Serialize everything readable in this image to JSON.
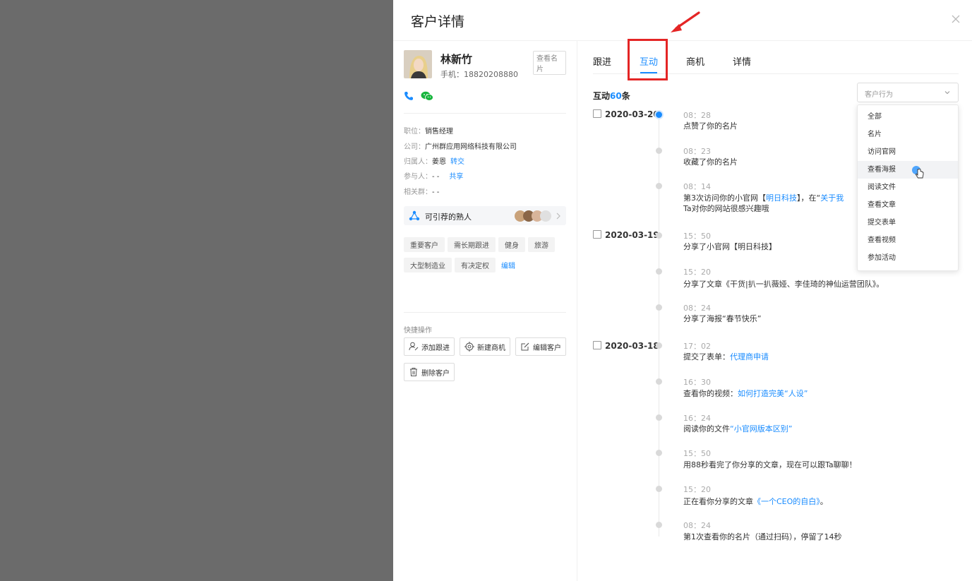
{
  "drawer": {
    "title": "客户详情"
  },
  "customer": {
    "name": "林新竹",
    "phone": "手机：18820208880",
    "view_card": "查看名片",
    "position_label": "职位：",
    "position": "销售经理",
    "company_label": "公司：",
    "company": "广州群应用网络科技有限公司",
    "owner_label": "归属人：",
    "owner": "姜恩",
    "owner_action": "转交",
    "participant_label": "参与人：",
    "participant": "- -",
    "participant_action": "共享",
    "group_label": "相关群：",
    "group": "- -",
    "referral": "可引荐的熟人",
    "tags": [
      "重要客户",
      "需长期跟进",
      "健身",
      "旅游",
      "大型制造业",
      "有决定权"
    ],
    "tags_edit": "编辑"
  },
  "quick_actions": {
    "title": "快捷操作",
    "add_follow": "添加跟进",
    "new_opportunity": "新建商机",
    "edit_customer": "编辑客户",
    "delete_customer": "删除客户"
  },
  "tabs": [
    "跟进",
    "互动",
    "商机",
    "详情"
  ],
  "interactions": {
    "count_prefix": "互动",
    "count": "60",
    "count_suffix": "条",
    "filter_placeholder": "客户行为",
    "filter_options": [
      "全部",
      "名片",
      "访问官网",
      "查看海报",
      "阅读文件",
      "查看文章",
      "提交表单",
      "查看视频",
      "参加活动"
    ]
  },
  "timeline": {
    "dates": [
      "2020-03-20",
      "2020-03-19",
      "2020-03-18"
    ],
    "events": [
      {
        "time": "08：28",
        "text": "点赞了你的名片"
      },
      {
        "time": "08：23",
        "text": "收藏了你的名片"
      },
      {
        "time": "08：14",
        "text_a": "第3次访问你的小官网【",
        "link_a": "明日科技",
        "text_b": "】，在“",
        "link_b": "关于我",
        "text_c": "Ta对你的网站很感兴趣哦"
      },
      {
        "time": "15：50",
        "text": "分享了小官网【明日科技】"
      },
      {
        "time": "15：20",
        "text": "分享了文章《干货|扒一扒薇娅、李佳琦的神仙运营团队》。"
      },
      {
        "time": "08：24",
        "text": "分享了海报“春节快乐”"
      },
      {
        "time": "17：02",
        "text": "提交了表单：",
        "link": "代理商申请"
      },
      {
        "time": "16：30",
        "text": "查看你的视频：",
        "link": "如何打造完美“人设”"
      },
      {
        "time": "16：24",
        "text": "阅读你的文件",
        "link": "“小官网版本区别”"
      },
      {
        "time": "15：50",
        "text": "用88秒看完了你分享的文章，现在可以跟Ta聊聊！"
      },
      {
        "time": "15：20",
        "text": "正在看你分享的文章",
        "link": "《一个CEO的自白》",
        "text_after": "。"
      },
      {
        "time": "08：24",
        "text": "第1次查看你的名片（通过扫码），停留了14秒"
      }
    ]
  },
  "colors": {
    "accent": "#1a8cff",
    "highlight": "#e42525",
    "overlay": "#6b6b6b"
  }
}
